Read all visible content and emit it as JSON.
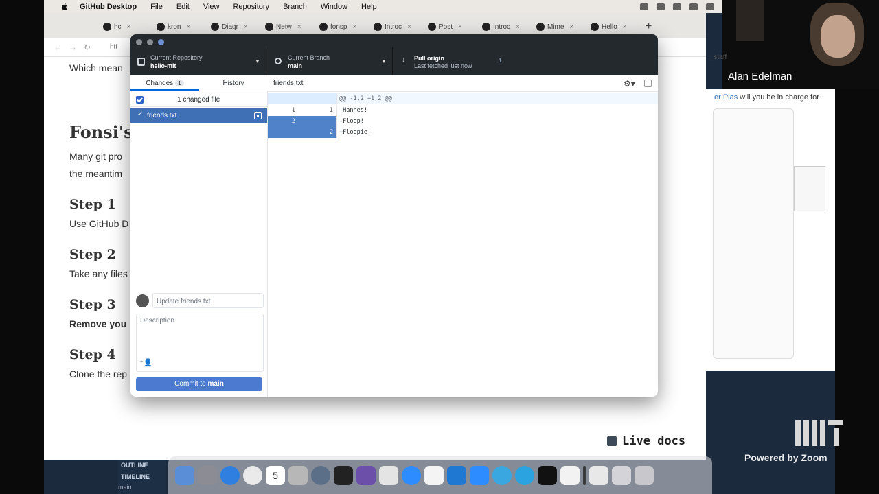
{
  "menubar": {
    "app": "GitHub Desktop",
    "items": [
      "File",
      "Edit",
      "View",
      "Repository",
      "Branch",
      "Window",
      "Help"
    ]
  },
  "zoom": {
    "speaker": "Alan Edelman",
    "watermark": "Powered by Zoom"
  },
  "browser": {
    "tabs": [
      "hc",
      "kron",
      "Diagr",
      "Netw",
      "fonsp",
      "Introc",
      "Post",
      "Introc",
      "Mime",
      "Hello"
    ],
    "url_fragment": "htt",
    "doc": {
      "line_top": "Which mean",
      "heading": "Fonsi's",
      "para_line1": "Many git pro",
      "para_line2": "the meantim",
      "step1": "Step 1",
      "step1_text": "Use GitHub D",
      "step2": "Step 2",
      "step2_text": "Take any files",
      "step3": "Step 3",
      "step3_text": "Remove you",
      "step4": "Step 4",
      "step4_text": "Clone the rep"
    },
    "live_docs": "Live docs",
    "outline": [
      "OUTLINE",
      "TIMELINE"
    ],
    "status_branch": "main"
  },
  "side_panel": {
    "staff": "_staff",
    "message_prefix": "er Plas",
    "message_rest": " will you be in charge for"
  },
  "dock": {
    "calendar_day": "5"
  },
  "github_desktop": {
    "repo": {
      "label": "Current Repository",
      "value": "hello-mit"
    },
    "branch": {
      "label": "Current Branch",
      "value": "main"
    },
    "pull": {
      "label": "Pull origin",
      "sub": "Last fetched just now",
      "badge": "1"
    },
    "tabs": {
      "changes": "Changes",
      "changes_count": "1",
      "history": "History"
    },
    "changed_summary": "1 changed file",
    "file": {
      "name": "friends.txt"
    },
    "diff": {
      "filename": "friends.txt",
      "lines": [
        {
          "type": "hunk",
          "old": "",
          "new": "",
          "text": "@@ -1,2 +1,2 @@"
        },
        {
          "type": "ctx",
          "old": "1",
          "new": "1",
          "text": " Hannes!"
        },
        {
          "type": "del",
          "old": "2",
          "new": "",
          "text": "-Floep!"
        },
        {
          "type": "add",
          "old": "",
          "new": "2",
          "text": "+Floepie!"
        }
      ]
    },
    "commit": {
      "summary_placeholder": "Update friends.txt",
      "description_placeholder": "Description",
      "button_prefix": "Commit to ",
      "button_branch": "main"
    }
  }
}
